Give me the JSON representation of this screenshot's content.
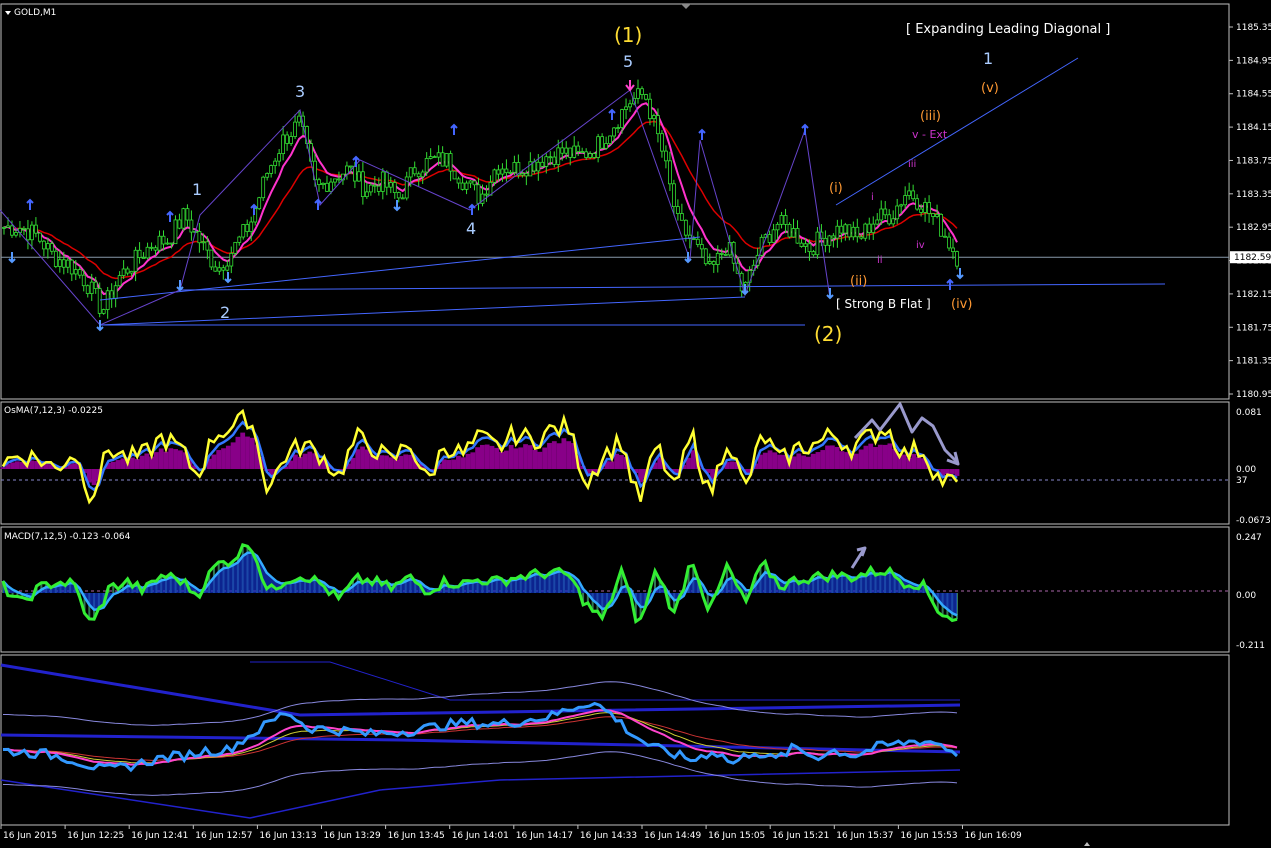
{
  "chart_title": "GOLD,M1",
  "colors": {
    "background": "#000000",
    "panel_border": "#c0c0c0",
    "candle_up": "#33dd33",
    "ma_fast": "#ff33cc",
    "ma_slow": "#dd0000",
    "fractal": "#4466ff",
    "wave_minor": "#aaccff",
    "wave_major": "#ffdd33",
    "wave_sub": "#ff9933",
    "wave_micro": "#cc33cc",
    "trendline": "#4466ff",
    "osma_line": "#ffff33",
    "osma_signal": "#3377ff",
    "osma_hist": "#880088",
    "macd_line": "#33ee33",
    "macd_signal": "#33aaff",
    "macd_hist": "#337755",
    "bands": "#3333cc"
  },
  "labels": {
    "ch_title": "[ Expanding Leading Diagonal ]",
    "strong_b": "[ Strong B Flat ]",
    "w1p": "(1)",
    "w2p": "(2)",
    "w1": "1",
    "w2": "2",
    "w3": "3",
    "w4": "4",
    "w5": "5",
    "w1r": "1",
    "wi": "(i)",
    "wii": "(ii)",
    "wiii": "(iii)",
    "wiv": "(iv)",
    "wv": "(v)",
    "mi": "i",
    "mii": "ii",
    "miii": "iii",
    "miv": "iv",
    "vext": "v - Ext"
  },
  "chart_data": [
    {
      "type": "candlestick",
      "title": "GOLD,M1",
      "ylim": [
        1180.95,
        1185.55
      ],
      "y_ticks": [
        "1185.35",
        "1184.95",
        "1184.55",
        "1184.15",
        "1183.75",
        "1183.35",
        "1182.95",
        "1182.55",
        "1182.15",
        "1181.75",
        "1181.35",
        "1180.95"
      ],
      "current_price": "1182.59",
      "x_ticks": [
        "16 Jun 2015",
        "16 Jun 12:25",
        "16 Jun 12:41",
        "16 Jun 12:57",
        "16 Jun 13:13",
        "16 Jun 13:29",
        "16 Jun 13:45",
        "16 Jun 14:01",
        "16 Jun 14:17",
        "16 Jun 14:33",
        "16 Jun 14:49",
        "16 Jun 15:05",
        "16 Jun 15:21",
        "16 Jun 15:37",
        "16 Jun 15:53",
        "16 Jun 16:09"
      ],
      "close": [
        1182.95,
        1182.95,
        1182.85,
        1182.6,
        1182.5,
        1182.3,
        1181.95,
        1182.35,
        1182.55,
        1182.75,
        1182.8,
        1183.1,
        1182.75,
        1182.45,
        1182.7,
        1183.0,
        1183.6,
        1184.0,
        1184.2,
        1183.4,
        1183.55,
        1183.65,
        1183.4,
        1183.5,
        1183.3,
        1183.65,
        1183.75,
        1183.75,
        1183.5,
        1183.3,
        1183.7,
        1183.65,
        1183.7,
        1183.8,
        1183.85,
        1183.8,
        1183.9,
        1184.15,
        1184.45,
        1184.55,
        1183.9,
        1183.0,
        1182.75,
        1182.4,
        1182.75,
        1182.15,
        1182.7,
        1183.0,
        1182.9,
        1182.7,
        1182.85,
        1182.95,
        1182.8,
        1183.05,
        1183.1,
        1183.4,
        1183.2,
        1182.95,
        1182.6
      ],
      "ma_fast_label": "pink MA",
      "ma_slow_label": "red MA"
    },
    {
      "type": "line",
      "title": "OsMA(7,12,3) -0.0225",
      "ylim": [
        -0.0673,
        0.081
      ],
      "y_ticks": [
        "0.081",
        "0.00",
        "-0.0673"
      ],
      "level_label": "37",
      "series": [
        {
          "name": "OsMA",
          "values": [
            0.01,
            0.02,
            0.015,
            0.0,
            0.025,
            -0.04,
            0.03,
            0.015,
            0.02,
            0.045,
            0.03,
            -0.01,
            0.05,
            0.06,
            0.075,
            -0.03,
            0.02,
            0.035,
            0.02,
            -0.01,
            0.045,
            0.03,
            0.01,
            0.04,
            -0.02,
            0.035,
            0.02,
            0.045,
            0.03,
            0.05,
            0.04,
            0.055,
            0.06,
            -0.02,
            0.02,
            0.04,
            -0.05,
            0.035,
            -0.03,
            0.05,
            -0.04,
            0.045,
            -0.03,
            0.05,
            0.01,
            0.03,
            0.035,
            0.05,
            0.03,
            0.045,
            0.06,
            0.02,
            0.03,
            -0.015,
            -0.02
          ]
        }
      ]
    },
    {
      "type": "line",
      "title": "MACD(7,12,5) -0.123 -0.064",
      "ylim": [
        -0.211,
        0.247
      ],
      "y_ticks": [
        "0.247",
        "0.00",
        "-0.211"
      ],
      "series": [
        {
          "name": "MACD",
          "values": [
            0.03,
            -0.05,
            0.02,
            0.05,
            0.04,
            -0.15,
            0.02,
            0.05,
            0.01,
            0.08,
            0.06,
            -0.01,
            0.12,
            0.15,
            0.23,
            0.0,
            0.06,
            0.08,
            0.04,
            -0.03,
            0.06,
            0.05,
            0.02,
            0.07,
            0.01,
            0.05,
            0.04,
            0.06,
            0.05,
            0.07,
            0.08,
            0.09,
            0.08,
            -0.05,
            -0.12,
            0.1,
            -0.15,
            0.11,
            -0.1,
            0.16,
            -0.09,
            0.12,
            -0.05,
            0.13,
            0.03,
            0.06,
            0.07,
            0.08,
            0.07,
            0.09,
            0.1,
            0.05,
            0.04,
            -0.08,
            -0.123
          ]
        }
      ]
    },
    {
      "type": "line",
      "title": "",
      "series": [
        {
          "name": "price",
          "values": [
            1182.9,
            1182.85,
            1182.8,
            1182.7,
            1182.5,
            1182.3,
            1182.4,
            1182.55,
            1182.7,
            1182.75,
            1182.9,
            1182.9,
            1183.3,
            1183.7,
            1184.1,
            1183.6,
            1183.55,
            1183.5,
            1183.4,
            1183.45,
            1183.5,
            1183.6,
            1183.7,
            1183.75,
            1183.7,
            1183.75,
            1183.85,
            1183.95,
            1184.2,
            1184.4,
            1184.0,
            1183.4,
            1183.0,
            1182.8,
            1182.6,
            1182.9,
            1182.5,
            1182.9,
            1182.6,
            1183.0,
            1182.7,
            1182.9,
            1182.75,
            1183.0,
            1183.1,
            1183.2,
            1183.15,
            1182.8
          ]
        }
      ]
    }
  ]
}
